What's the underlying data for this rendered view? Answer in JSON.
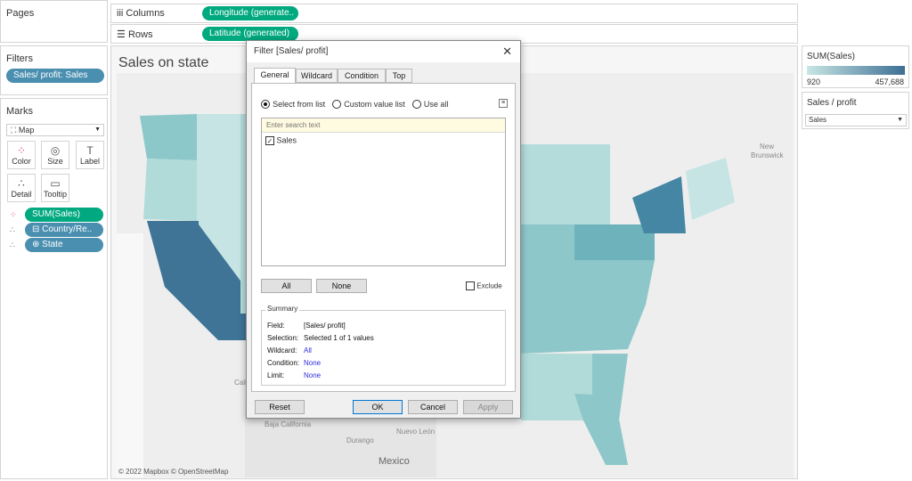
{
  "pages": {
    "title": "Pages"
  },
  "shelves": {
    "columns_label": "Columns",
    "columns_pill": "Longitude (generate..",
    "rows_label": "Rows",
    "rows_pill": "Latitude (generated)"
  },
  "filters": {
    "title": "Filters",
    "pill": "Sales/ profit: Sales"
  },
  "marks": {
    "title": "Marks",
    "type": "Map",
    "buttons": [
      "Color",
      "Size",
      "Label",
      "Detail",
      "Tooltip"
    ],
    "fields": [
      "SUM(Sales)",
      "Country/Re..",
      "State"
    ]
  },
  "sheet": {
    "title": "Sales on state",
    "attribution": "© 2022 Mapbox © OpenStreetMap",
    "map_labels": [
      "New",
      "Brunswick",
      "Calif",
      "Baja California",
      "Durango",
      "Nuevo León",
      "Mexico"
    ]
  },
  "legend": {
    "title": "SUM(Sales)",
    "min": "920",
    "max": "457,688",
    "colors": [
      "#c8e6e4",
      "#3d6f94"
    ]
  },
  "param": {
    "title": "Sales / profit",
    "value": "Sales"
  },
  "dialog": {
    "title": "Filter [Sales/ profit]",
    "tabs": [
      "General",
      "Wildcard",
      "Condition",
      "Top"
    ],
    "radios": [
      "Select from list",
      "Custom value list",
      "Use all"
    ],
    "search_placeholder": "Enter search text",
    "items": [
      {
        "label": "Sales",
        "checked": true
      }
    ],
    "all_btn": "All",
    "none_btn": "None",
    "exclude": "Exclude",
    "summary": {
      "title": "Summary",
      "rows": [
        {
          "label": "Field:",
          "value": "[Sales/ profit]"
        },
        {
          "label": "Selection:",
          "value": "Selected 1 of 1 values"
        },
        {
          "label": "Wildcard:",
          "value": "All"
        },
        {
          "label": "Condition:",
          "value": "None"
        },
        {
          "label": "Limit:",
          "value": "None"
        }
      ]
    },
    "footer": {
      "reset": "Reset",
      "ok": "OK",
      "cancel": "Cancel",
      "apply": "Apply"
    }
  }
}
